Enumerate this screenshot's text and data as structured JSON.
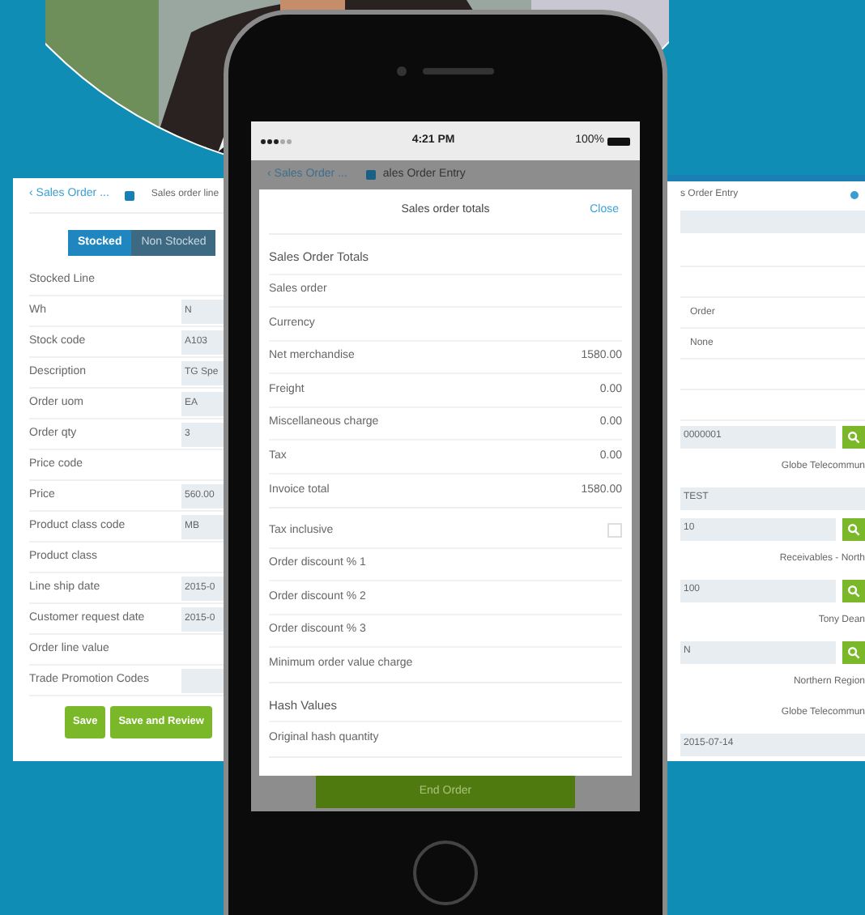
{
  "left_panel": {
    "back_link": "‹ Sales Order ...",
    "breadcrumb": "Sales order line",
    "tabs": [
      {
        "label": "Stocked",
        "selected": true
      },
      {
        "label": "Non Stocked",
        "selected": false
      }
    ],
    "rows": [
      {
        "kind": "heading",
        "label": "Stocked Line"
      },
      {
        "kind": "field",
        "label": "Wh",
        "value": "N"
      },
      {
        "kind": "field",
        "label": "Stock code",
        "value": "A103"
      },
      {
        "kind": "field",
        "label": "Description",
        "value": "TG Spe"
      },
      {
        "kind": "field",
        "label": "Order uom",
        "value": "EA"
      },
      {
        "kind": "field",
        "label": "Order qty",
        "value": "3"
      },
      {
        "kind": "heading",
        "label": "Price code"
      },
      {
        "kind": "field",
        "label": "Price",
        "value": "560.00"
      },
      {
        "kind": "field",
        "label": "Product class code",
        "value": "MB"
      },
      {
        "kind": "heading",
        "label": "Product class"
      },
      {
        "kind": "field",
        "label": "Line ship date",
        "value": "2015-0"
      },
      {
        "kind": "field",
        "label": "Customer request date",
        "value": "2015-0"
      },
      {
        "kind": "heading",
        "label": "Order line value"
      },
      {
        "kind": "field",
        "label": "Trade Promotion Codes",
        "value": ""
      }
    ],
    "buttons": [
      "Save",
      "Save and Review"
    ]
  },
  "right_panel": {
    "breadcrumb": "s Order Entry",
    "rows": [
      {
        "kind": "bar"
      },
      {
        "kind": "blank"
      },
      {
        "kind": "blank"
      },
      {
        "kind": "label",
        "text": "Order"
      },
      {
        "kind": "label",
        "text": "None"
      },
      {
        "kind": "blank"
      },
      {
        "kind": "blank"
      },
      {
        "kind": "lookup",
        "text": "0000001"
      },
      {
        "kind": "caption",
        "text": "Globe Telecommun"
      },
      {
        "kind": "field",
        "text": "TEST"
      },
      {
        "kind": "lookup",
        "text": "10"
      },
      {
        "kind": "caption",
        "text": "Receivables - North"
      },
      {
        "kind": "lookup",
        "text": "100"
      },
      {
        "kind": "caption",
        "text": "Tony Dean"
      },
      {
        "kind": "lookup",
        "text": "N"
      },
      {
        "kind": "caption",
        "text": "Northern Region"
      },
      {
        "kind": "caption",
        "text": "Globe Telecommun"
      },
      {
        "kind": "field",
        "text": "2015-07-14"
      }
    ]
  },
  "phone": {
    "status_bar": {
      "time": "4:21 PM",
      "battery": "100%"
    },
    "nav": {
      "back_link": "‹ Sales Order ...",
      "title": "ales Order Entry"
    },
    "modal": {
      "title": "Sales order totals",
      "close": "Close",
      "groups": [
        [
          {
            "kind": "heading",
            "label": "Sales Order Totals"
          },
          {
            "kind": "value",
            "label": "Sales order"
          },
          {
            "kind": "value",
            "label": "Currency"
          },
          {
            "kind": "value",
            "label": "Net merchandise",
            "value": "1580.00"
          },
          {
            "kind": "value",
            "label": "Freight",
            "value": "0.00"
          },
          {
            "kind": "value",
            "label": "Miscellaneous charge",
            "value": "0.00"
          },
          {
            "kind": "value",
            "label": "Tax",
            "value": "0.00"
          },
          {
            "kind": "value",
            "label": "Invoice total",
            "value": "1580.00"
          }
        ],
        [
          {
            "kind": "check",
            "label": "Tax inclusive",
            "checked": false
          },
          {
            "kind": "value",
            "label": "Order discount % 1"
          },
          {
            "kind": "value",
            "label": "Order discount % 2"
          },
          {
            "kind": "value",
            "label": "Order discount % 3"
          },
          {
            "kind": "value",
            "label": "Minimum order value charge"
          }
        ],
        [
          {
            "kind": "heading",
            "label": "Hash Values"
          },
          {
            "kind": "value",
            "label": "Original hash quantity"
          }
        ]
      ]
    },
    "end_button": "End Order"
  }
}
